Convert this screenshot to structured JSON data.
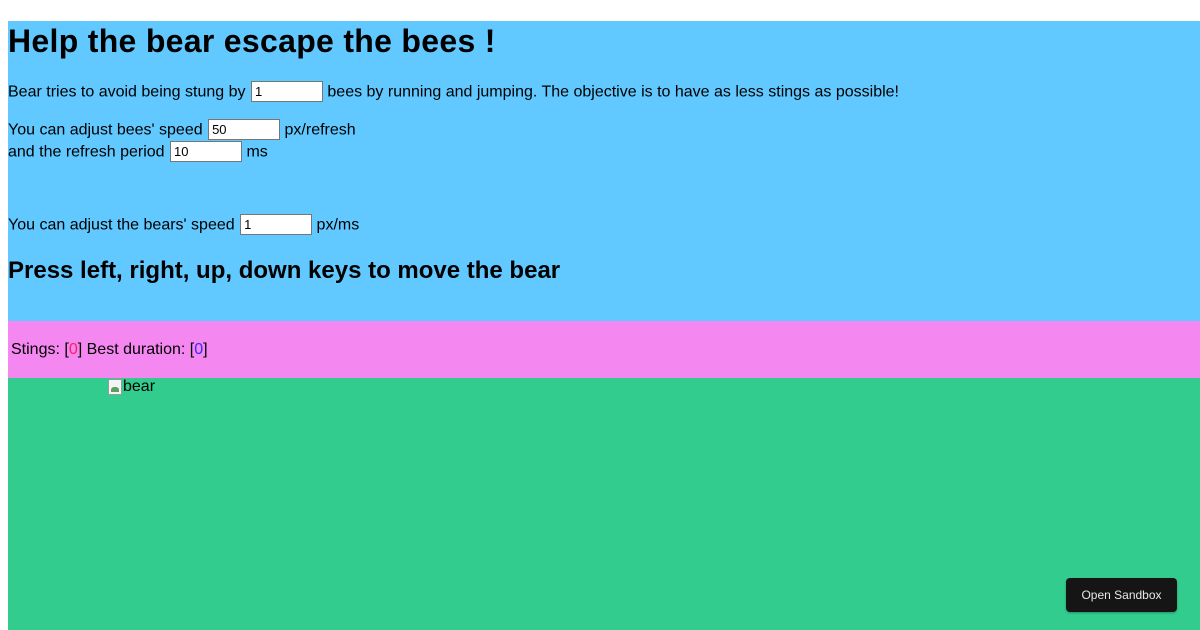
{
  "header": {
    "title": "Help the bear escape the bees !",
    "bees_prefix": "Bear tries to avoid being stung by",
    "bees_value": "1",
    "bees_suffix": "bees by running and jumping. The objective is to have as less stings as possible!",
    "speed_prefix": "You can adjust bees' speed",
    "speed_value": "50",
    "speed_unit": "px/refresh",
    "period_prefix": "and the refresh period",
    "period_value": "10",
    "period_unit": "ms",
    "bear_speed_prefix": "You can adjust the bears' speed",
    "bear_speed_value": "1",
    "bear_speed_unit": "px/ms",
    "instructions": "Press left, right, up, down keys to move the bear"
  },
  "score": {
    "stings_label": "Stings: [",
    "stings_value": "0",
    "stings_close": "]",
    "best_label": "Best duration: [",
    "best_value": "0",
    "best_close": "]"
  },
  "game": {
    "bear_alt": "bear"
  },
  "sandbox": {
    "button_label": "Open Sandbox"
  },
  "colors": {
    "header_bg": "#61c9ff",
    "score_bg": "#f587f0",
    "board_bg": "#33cc8f",
    "stings_color": "#ff1e60",
    "best_color": "#3a27ff"
  }
}
